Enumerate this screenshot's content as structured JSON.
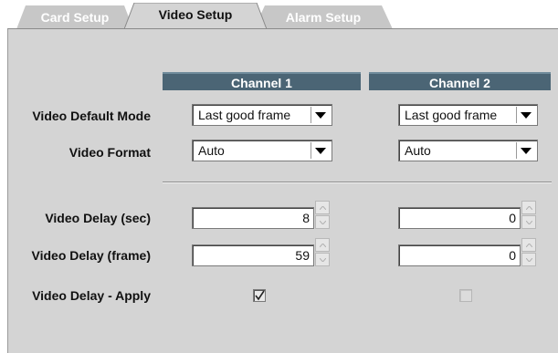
{
  "tabs": [
    {
      "label": "Card Setup",
      "active": false
    },
    {
      "label": "Video Setup",
      "active": true
    },
    {
      "label": "Alarm Setup",
      "active": false
    }
  ],
  "channels": [
    "Channel 1",
    "Channel 2"
  ],
  "rows": {
    "video_default_mode": {
      "label": "Video Default Mode",
      "channel1": "Last good frame",
      "channel2": "Last good frame"
    },
    "video_format": {
      "label": "Video Format",
      "channel1": "Auto",
      "channel2": "Auto"
    },
    "video_delay_sec": {
      "label": "Video Delay (sec)",
      "channel1": "8",
      "channel2": "0"
    },
    "video_delay_frame": {
      "label": "Video Delay (frame)",
      "channel1": "59",
      "channel2": "0"
    },
    "video_delay_apply": {
      "label": "Video Delay - Apply",
      "channel1_checked": true,
      "channel2_checked": false,
      "channel2_enabled": false
    }
  },
  "icons": {
    "dropdown": "triangle-down-icon",
    "spin_up": "chevron-up-icon",
    "spin_down": "chevron-down-icon",
    "check": "checkmark-icon"
  },
  "colors": {
    "header_bg": "#4b6575",
    "panel_bg": "#d4d4d4",
    "inactive_tab": "#c7c7c7",
    "active_tab": "#d4d4d4"
  }
}
